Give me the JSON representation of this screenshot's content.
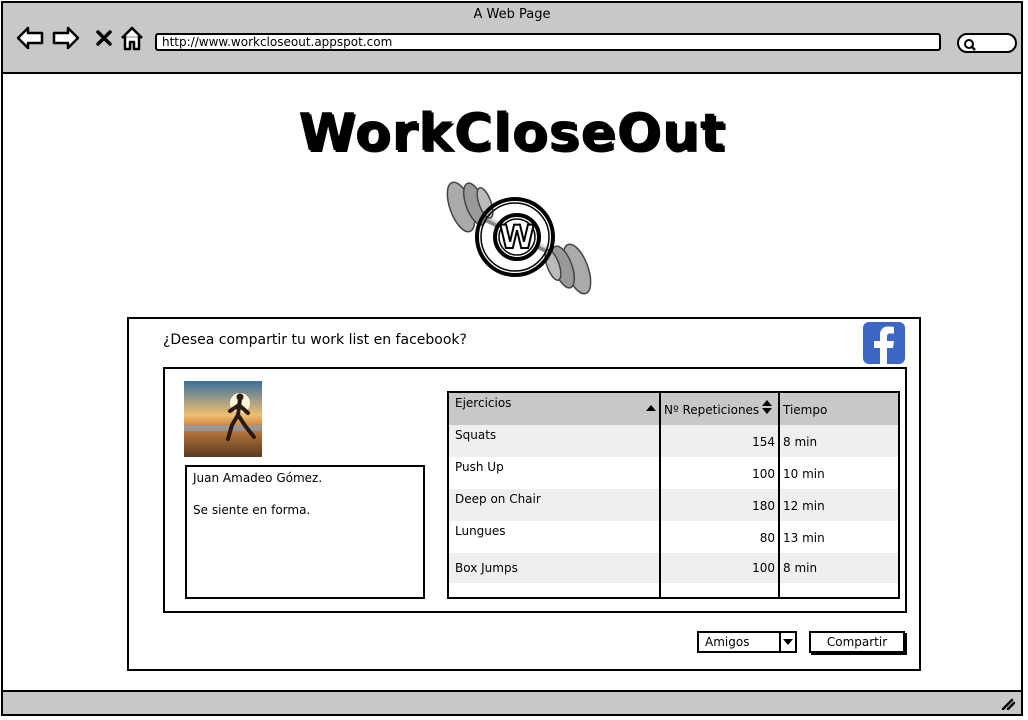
{
  "browser": {
    "window_title": "A Web Page",
    "url": "http://www.workcloseout.appspot.com"
  },
  "page": {
    "site_title": "WorkCloseOut",
    "logo_letter": "W"
  },
  "share": {
    "prompt": "¿Desea compartir tu work list en facebook?",
    "user_name": "Juan Amadeo Gómez.",
    "user_status": "Se siente en forma.",
    "audience_selected": "Amigos",
    "share_label": "Compartir"
  },
  "table": {
    "headers": [
      "Ejercicios",
      "Nº Repeticiones",
      "Tiempo"
    ],
    "rows": [
      {
        "exercise": "Squats",
        "reps": "154",
        "time": "8 min"
      },
      {
        "exercise": "Push Up",
        "reps": "100",
        "time": "10 min"
      },
      {
        "exercise": "Deep on Chair",
        "reps": "180",
        "time": "12 min"
      },
      {
        "exercise": "Lungues",
        "reps": "80",
        "time": "13 min"
      },
      {
        "exercise": "Box Jumps",
        "reps": "100",
        "time": "8 min"
      }
    ]
  },
  "colors": {
    "chrome": "#c8c8c8",
    "facebook": "#3b66c4",
    "row_stripe": "#efefef"
  },
  "icons": [
    "back-arrow-icon",
    "forward-arrow-icon",
    "close-icon",
    "home-icon",
    "search-icon",
    "facebook-icon",
    "sort-up-icon",
    "sort-icon",
    "chevron-down-icon",
    "resize-grip-icon"
  ]
}
